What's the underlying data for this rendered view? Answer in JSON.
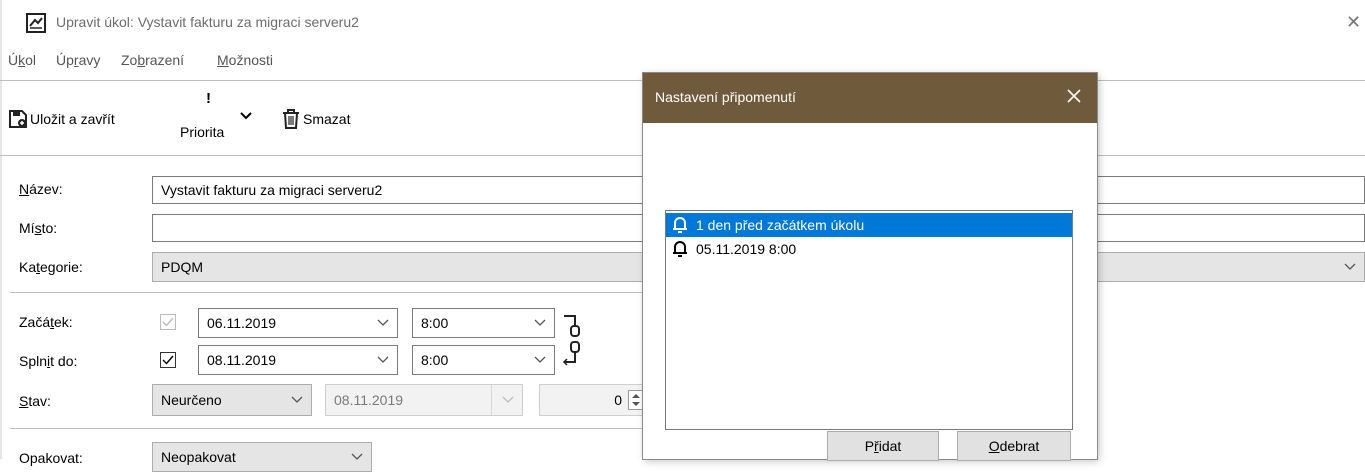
{
  "window": {
    "title": "Upravit úkol: Vystavit fakturu za migraci serveru2"
  },
  "menu": [
    {
      "pre": "Ú",
      "u": "k",
      "post": "ol"
    },
    {
      "pre": "Úp",
      "u": "r",
      "post": "avy"
    },
    {
      "pre": "Zo",
      "u": "b",
      "post": "razení"
    },
    {
      "pre": "",
      "u": "M",
      "post": "ožnosti"
    }
  ],
  "toolbar": {
    "save_close": "Uložit a zavřít",
    "priority_mark": "!",
    "priority": "Priorita",
    "delete": "Smazat"
  },
  "form": {
    "name_label": {
      "pre": "",
      "u": "N",
      "post": "ázev:"
    },
    "name_value": "Vystavit fakturu za migraci serveru2",
    "place_label": {
      "pre": "Mí",
      "u": "s",
      "post": "to:"
    },
    "place_value": "",
    "category_label": {
      "pre": "Ka",
      "u": "t",
      "post": "egorie:"
    },
    "category_value": "PDQM",
    "start_label": {
      "pre": "Začá",
      "u": "t",
      "post": "ek:"
    },
    "start_date": "06.11.2019",
    "start_time": "8:00",
    "due_label": {
      "pre": "Spln",
      "u": "i",
      "post": "t do:"
    },
    "due_date": "08.11.2019",
    "due_time": "8:00",
    "status_label": {
      "pre": "",
      "u": "S",
      "post": "tav:"
    },
    "status_value": "Neurčeno",
    "status_date": "08.11.2019",
    "status_percent": "0",
    "repeat_label": "Opakovat:",
    "repeat_value": "Neopakovat"
  },
  "dialog": {
    "title": "Nastavení připomenutí",
    "reminders": [
      {
        "label": "1 den před začátkem úkolu",
        "selected": true
      },
      {
        "label": "05.11.2019 8:00",
        "selected": false
      }
    ],
    "add_button": {
      "pre": "P",
      "u": "ř",
      "post": "idat"
    },
    "remove_button": {
      "pre": "",
      "u": "O",
      "post": "debrat"
    }
  },
  "colors": {
    "dialog_titlebar": "#6f5a3c",
    "selection": "#0078d7"
  }
}
